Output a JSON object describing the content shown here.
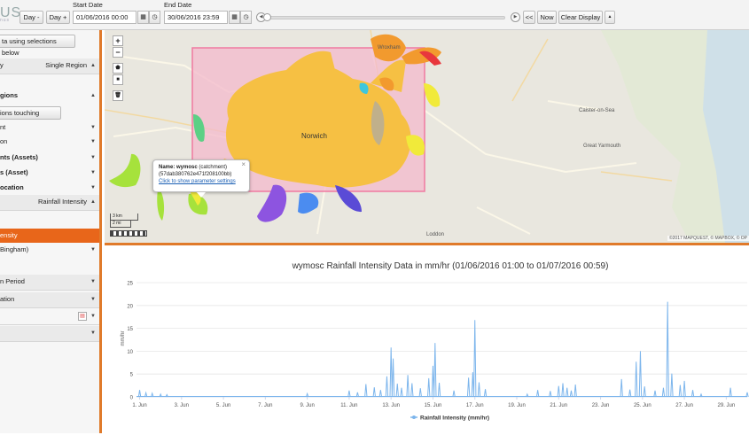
{
  "toolbar": {
    "logo": "US",
    "logo_sub": "nus",
    "start_label": "Start Date",
    "end_label": "End Date",
    "day_minus": "Day -",
    "day_plus": "Day +",
    "start_value": "01/06/2016 00:00",
    "end_value": "30/06/2016 23:59",
    "rewind": "<<",
    "now": "Now",
    "clear": "Clear Display",
    "collapse": "▲"
  },
  "sidebar": {
    "top_button": "ta using selections below",
    "rows": [
      {
        "label": "y",
        "right": "Single Region"
      },
      {
        "label": "gions"
      },
      {
        "label": "ions touching polygon"
      },
      {
        "label": "nt"
      },
      {
        "label": "on"
      },
      {
        "label": "nts (Assets)"
      },
      {
        "label": "s (Asset)"
      },
      {
        "label": "ocation"
      },
      {
        "label": "",
        "right": "Rainfall Intensity"
      },
      {
        "label": "ensity"
      },
      {
        "label": "Bingham)"
      },
      {
        "label": "n Period"
      },
      {
        "label": "ation"
      }
    ]
  },
  "map": {
    "zoom_in": "+",
    "zoom_out": "−",
    "city": "Norwich",
    "scale_km": "3 km",
    "scale_mi": "2 mi",
    "attribution": "©2017 MAPQUEST, © MAPBOX, © OP",
    "places": [
      "Wroxham",
      "Loddon",
      "Caister-on-Sea",
      "Great Yarmouth"
    ],
    "popup": {
      "name_label": "Name:",
      "name_value": "wymosc",
      "name_type": "(catchment)",
      "id": "(57dab380762e471f208100bb)",
      "link": "Click to show parameter settings",
      "close": "×"
    }
  },
  "chart_data": {
    "type": "line",
    "title": "wymosc Rainfall Intensity Data in mm/hr (01/06/2016 01:00 to 01/07/2016 00:59)",
    "ylabel": "mm/hr",
    "xlabel": "",
    "ylim": [
      0,
      25
    ],
    "yticks": [
      0,
      5,
      10,
      15,
      20,
      25
    ],
    "xticks": [
      "1. Jun",
      "3. Jun",
      "5. Jun",
      "7. Jun",
      "9. Jun",
      "11. Jun",
      "13. Jun",
      "15. Jun",
      "17. Jun",
      "19. Jun",
      "21. Jun",
      "23. Jun",
      "25. Jun",
      "27. Jun",
      "29. Jun"
    ],
    "series_name": "Rainfall Intensity (mm/hr)",
    "color": "#7cb5ec",
    "x": [
      1.0,
      1.3,
      1.6,
      2.0,
      2.3,
      9.0,
      11.0,
      11.4,
      11.8,
      12.2,
      12.5,
      12.8,
      13.0,
      13.1,
      13.3,
      13.5,
      13.8,
      14.0,
      14.4,
      14.8,
      15.0,
      15.1,
      15.3,
      16.0,
      16.7,
      16.9,
      17.0,
      17.2,
      17.5,
      19.5,
      20.0,
      20.6,
      21.0,
      21.2,
      21.4,
      21.6,
      21.8,
      24.0,
      24.4,
      24.7,
      24.9,
      25.1,
      25.6,
      26.0,
      26.2,
      26.4,
      26.8,
      27.0,
      27.4,
      27.8,
      29.2,
      30.0
    ],
    "y": [
      1.5,
      0.9,
      0.8,
      0.6,
      0.5,
      0.7,
      1.4,
      1.0,
      2.8,
      2.1,
      1.5,
      4.5,
      10.8,
      8.4,
      2.9,
      2.0,
      4.8,
      3.0,
      1.9,
      4.1,
      6.8,
      11.8,
      3.1,
      1.4,
      4.2,
      5.4,
      16.8,
      3.2,
      1.7,
      0.6,
      1.5,
      1.3,
      2.4,
      3.0,
      2.0,
      1.4,
      2.7,
      3.9,
      1.6,
      7.7,
      10.0,
      2.3,
      1.4,
      2.0,
      20.8,
      5.1,
      2.6,
      3.5,
      1.5,
      0.6,
      2.0,
      1.0
    ]
  }
}
